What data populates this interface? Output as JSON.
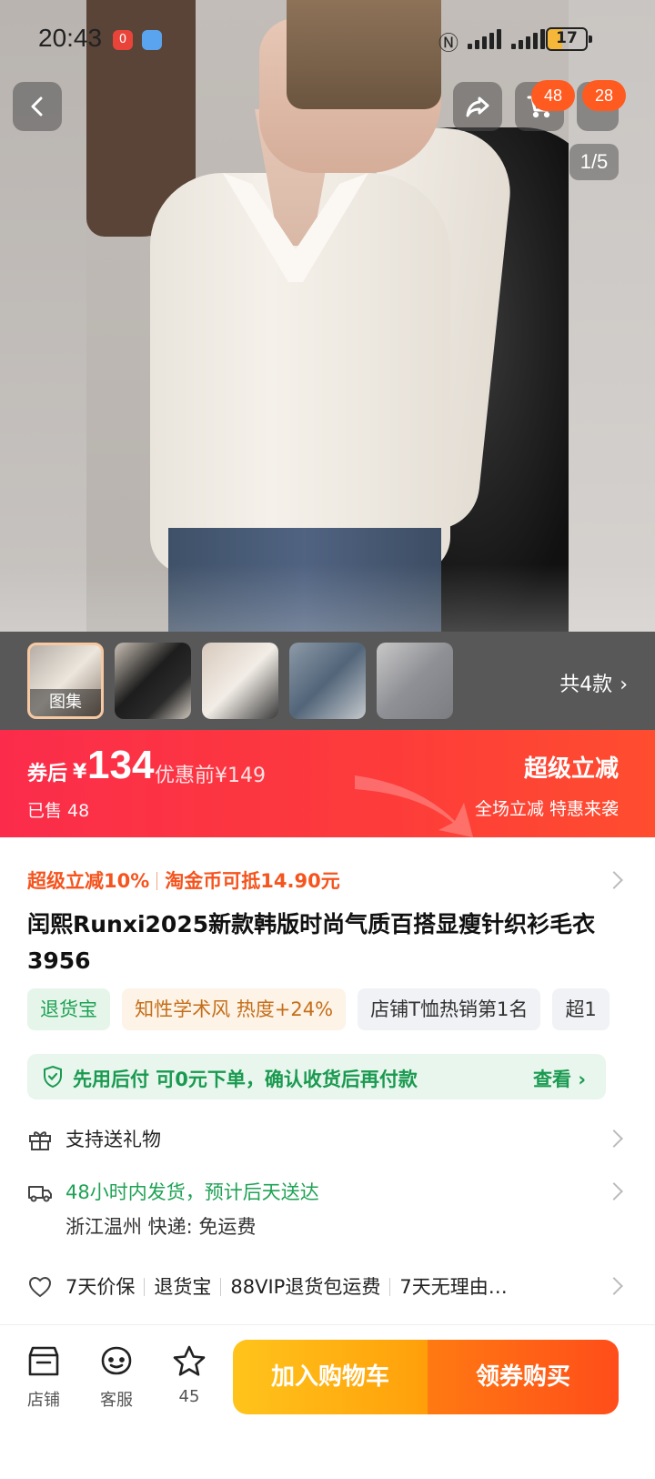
{
  "status_bar": {
    "time": "20:43",
    "notif_badge": "0",
    "battery": "17"
  },
  "nav": {
    "cart_count": "48",
    "more_count": "28",
    "image_pager": "1/5"
  },
  "thumbnails": {
    "first_label": "图集",
    "more_styles": "共4款"
  },
  "price": {
    "after_coupon_label": "券后",
    "currency": "¥",
    "value": "134",
    "before_discount": "优惠前¥149",
    "sold": "已售 48",
    "promo_title": "超级立减",
    "promo_subtitle": "全场立减 特惠来袭"
  },
  "promo_line": {
    "item1": "超级立减10%",
    "item2": "淘金币可抵14.90元"
  },
  "product": {
    "title": "闰熙Runxi2025新款韩版时尚气质百搭显瘦针织衫毛衣3956"
  },
  "tags": [
    "退货宝",
    "知性学术风 热度+24%",
    "店铺T恤热销第1名",
    "超1"
  ],
  "bnpl": {
    "text": "先用后付 可0元下单，确认收货后再付款",
    "view": "查看"
  },
  "gift": {
    "label": "支持送礼物"
  },
  "shipping": {
    "label": "48小时内发货，预计后天送达",
    "sub": "浙江温州 快递: 免运费"
  },
  "services": [
    "7天价保",
    "退货宝",
    "88VIP退货包运费",
    "7天无理由…"
  ],
  "bottom_bar": {
    "shop": "店铺",
    "service": "客服",
    "favorites": "45",
    "add_to_cart": "加入购物车",
    "buy": "领券购买"
  },
  "colors": {
    "accent_red": "#fb2c4b",
    "accent_orange": "#ff7a12",
    "green": "#1fa255"
  }
}
